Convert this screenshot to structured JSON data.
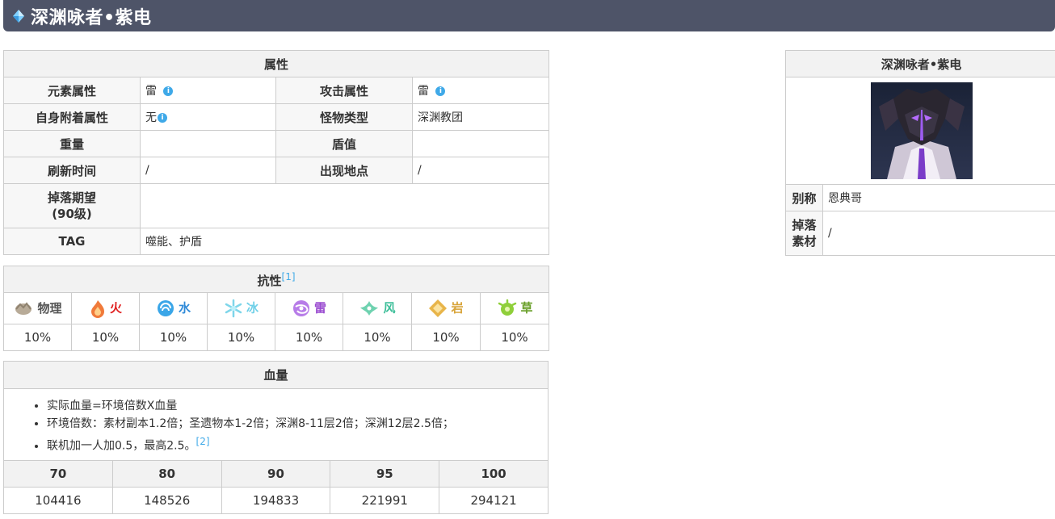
{
  "title": "深渊咏者•紫电",
  "attributes": {
    "header": "属性",
    "element_label": "元素属性",
    "element_value": "雷",
    "attack_label": "攻击属性",
    "attack_value": "雷",
    "self_attach_label": "自身附着属性",
    "self_attach_value": "无",
    "monster_type_label": "怪物类型",
    "monster_type_value": "深渊教团",
    "weight_label": "重量",
    "weight_value": "",
    "shield_label": "盾值",
    "shield_value": "",
    "refresh_label": "刷新时间",
    "refresh_value": "/",
    "location_label": "出现地点",
    "location_value": "/",
    "drop_label_line1": "掉落期望",
    "drop_label_line2": "(90级)",
    "drop_value": "",
    "tag_label": "TAG",
    "tag_value": "噬能、护盾"
  },
  "resistance": {
    "header": "抗性",
    "ref": "[1]",
    "elements": [
      {
        "name": "物理",
        "value": "10%",
        "color": "#555555"
      },
      {
        "name": "火",
        "value": "10%",
        "color": "#e02020"
      },
      {
        "name": "水",
        "value": "10%",
        "color": "#2f8ad8"
      },
      {
        "name": "冰",
        "value": "10%",
        "color": "#6fd0e8"
      },
      {
        "name": "雷",
        "value": "10%",
        "color": "#9a4bd0"
      },
      {
        "name": "风",
        "value": "10%",
        "color": "#3fbf9a"
      },
      {
        "name": "岩",
        "value": "10%",
        "color": "#d8a43a"
      },
      {
        "name": "草",
        "value": "10%",
        "color": "#6aa02a"
      }
    ]
  },
  "hp": {
    "header": "血量",
    "notes": [
      "实际血量=环境倍数X血量",
      "环境倍数：素材副本1.2倍；圣遗物本1-2倍；深渊8-11层2倍；深渊12层2.5倍；",
      "联机加一人加0.5，最高2.5。"
    ],
    "note_ref": "[2]",
    "levels": [
      "70",
      "80",
      "90",
      "95",
      "100"
    ],
    "values": [
      "104416",
      "148526",
      "194833",
      "221991",
      "294121"
    ]
  },
  "side": {
    "name": "深渊咏者•紫电",
    "alias_label": "别称",
    "alias_value": "恩典哥",
    "drop_label_line1": "掉落",
    "drop_label_line2": "素材",
    "drop_value": "/"
  },
  "colors": {
    "title_bar": "#4e5468",
    "link": "#3fa9e8",
    "header_bg": "#f2f2f2"
  }
}
